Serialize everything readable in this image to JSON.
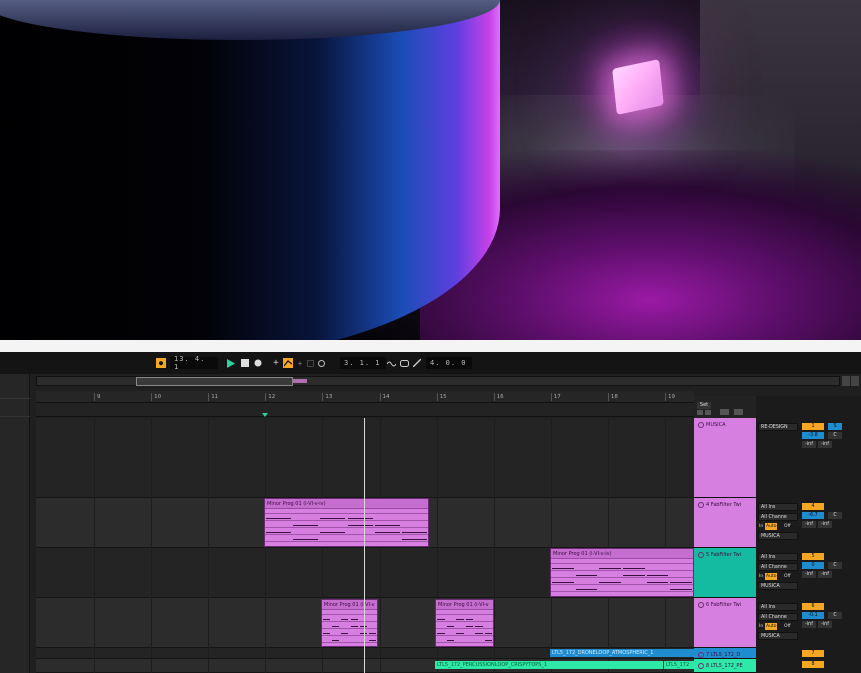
{
  "colors": {
    "clip_pink": "#d77fe0",
    "audio_blue": "#1f8ccf",
    "audio_green": "#2ee8a8",
    "track_teal": "#14bba0",
    "accent_orange": "#f5a623",
    "play_green": "#2ad4a0"
  },
  "transport": {
    "arrangement_position": "13.  4.  1",
    "loop_start": "3.  1.  1",
    "loop_length": "4.  0.  0",
    "icons": [
      "play-icon",
      "stop-icon",
      "record-icon",
      "metronome-icon",
      "loop-icon"
    ]
  },
  "ruler": {
    "bars": [
      "9",
      "10",
      "11",
      "12",
      "13",
      "14",
      "15",
      "16",
      "17",
      "18",
      "19"
    ]
  },
  "clips": {
    "midi_1": "Minor Prog 01 (i-VI-v-iv)",
    "midi_2": "Minor Prog 01 (i-VI-v-iv)",
    "midi_3": "Minor Prog 01 (i-VI-v",
    "midi_4": "Minor Prog 01 (i-VI-v"
  },
  "audio_clips": {
    "drone": "LTL5_172_DRONELOOP_ATMOSPHERIC_1",
    "perc": "LTL5_172_PERCUSSIONLOOP_CRISPYTOPS_1",
    "perc_tail": "LTL5_172"
  },
  "mixer": {
    "set_label": "Set",
    "tracks": [
      {
        "name": "MUSICA",
        "input": "RE-DESIGN",
        "vol": "-3.8",
        "pan": "C",
        "s1": "-inf",
        "s2": "-inf",
        "num": "1",
        "extra": "S"
      },
      {
        "name": "4 FabFilter Twi",
        "input": "All Ins",
        "channel": "All Channe",
        "monitor_in": "In",
        "monitor_auto": "Auto",
        "monitor_off": "Off",
        "out": "MUSICA",
        "num": "4",
        "vol": "-6.7",
        "pan": "C",
        "s1": "-inf",
        "s2": "-inf"
      },
      {
        "name": "5 FabFilter Twi",
        "input": "All Ins",
        "channel": "All Channe",
        "monitor_in": "In",
        "monitor_auto": "Auto",
        "monitor_off": "Off",
        "out": "MUSICA",
        "num": "5",
        "vol": "0",
        "pan": "C",
        "s1": "-inf",
        "s2": "-inf"
      },
      {
        "name": "6 FabFilter Twi",
        "input": "All Ins",
        "channel": "All Channe",
        "monitor_in": "In",
        "monitor_auto": "Auto",
        "monitor_off": "Off",
        "out": "MUSICA",
        "num": "6",
        "vol": "-0.1",
        "pan": "C",
        "s1": "-inf",
        "s2": "-inf"
      },
      {
        "name": "7 LTL5_172_D",
        "num": "7"
      },
      {
        "name": "8 LTL5_172_PE",
        "num": "8"
      }
    ]
  }
}
